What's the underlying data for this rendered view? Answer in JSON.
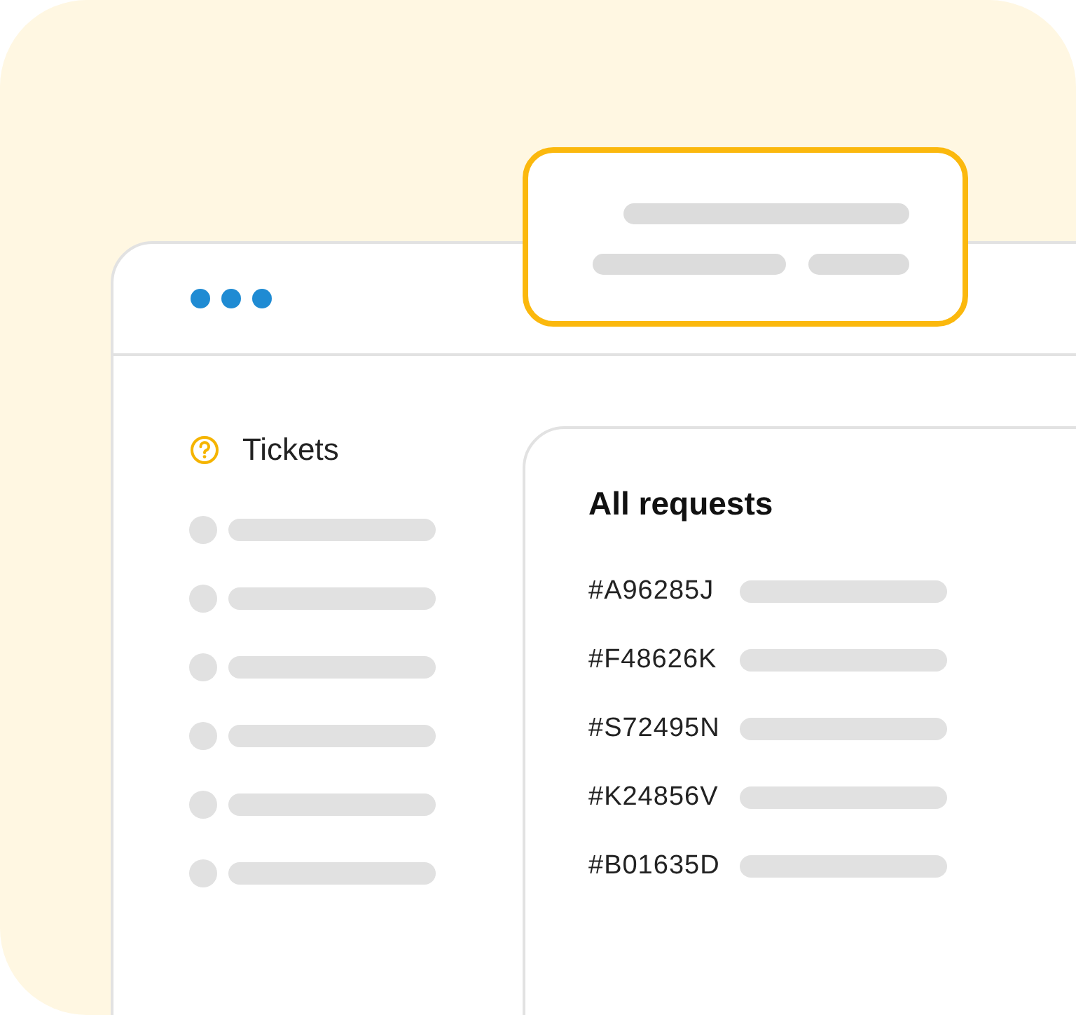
{
  "sidebar": {
    "title": "Tickets",
    "items": [
      {
        "kind": "placeholder"
      },
      {
        "kind": "placeholder"
      },
      {
        "kind": "placeholder"
      },
      {
        "kind": "placeholder"
      },
      {
        "kind": "placeholder"
      },
      {
        "kind": "placeholder"
      }
    ]
  },
  "panel": {
    "title": "All requests",
    "requests": [
      {
        "id": "#A96285J"
      },
      {
        "id": "#F48626K"
      },
      {
        "id": "#S72495N"
      },
      {
        "id": "#K24856V"
      },
      {
        "id": "#B01635D"
      }
    ]
  }
}
